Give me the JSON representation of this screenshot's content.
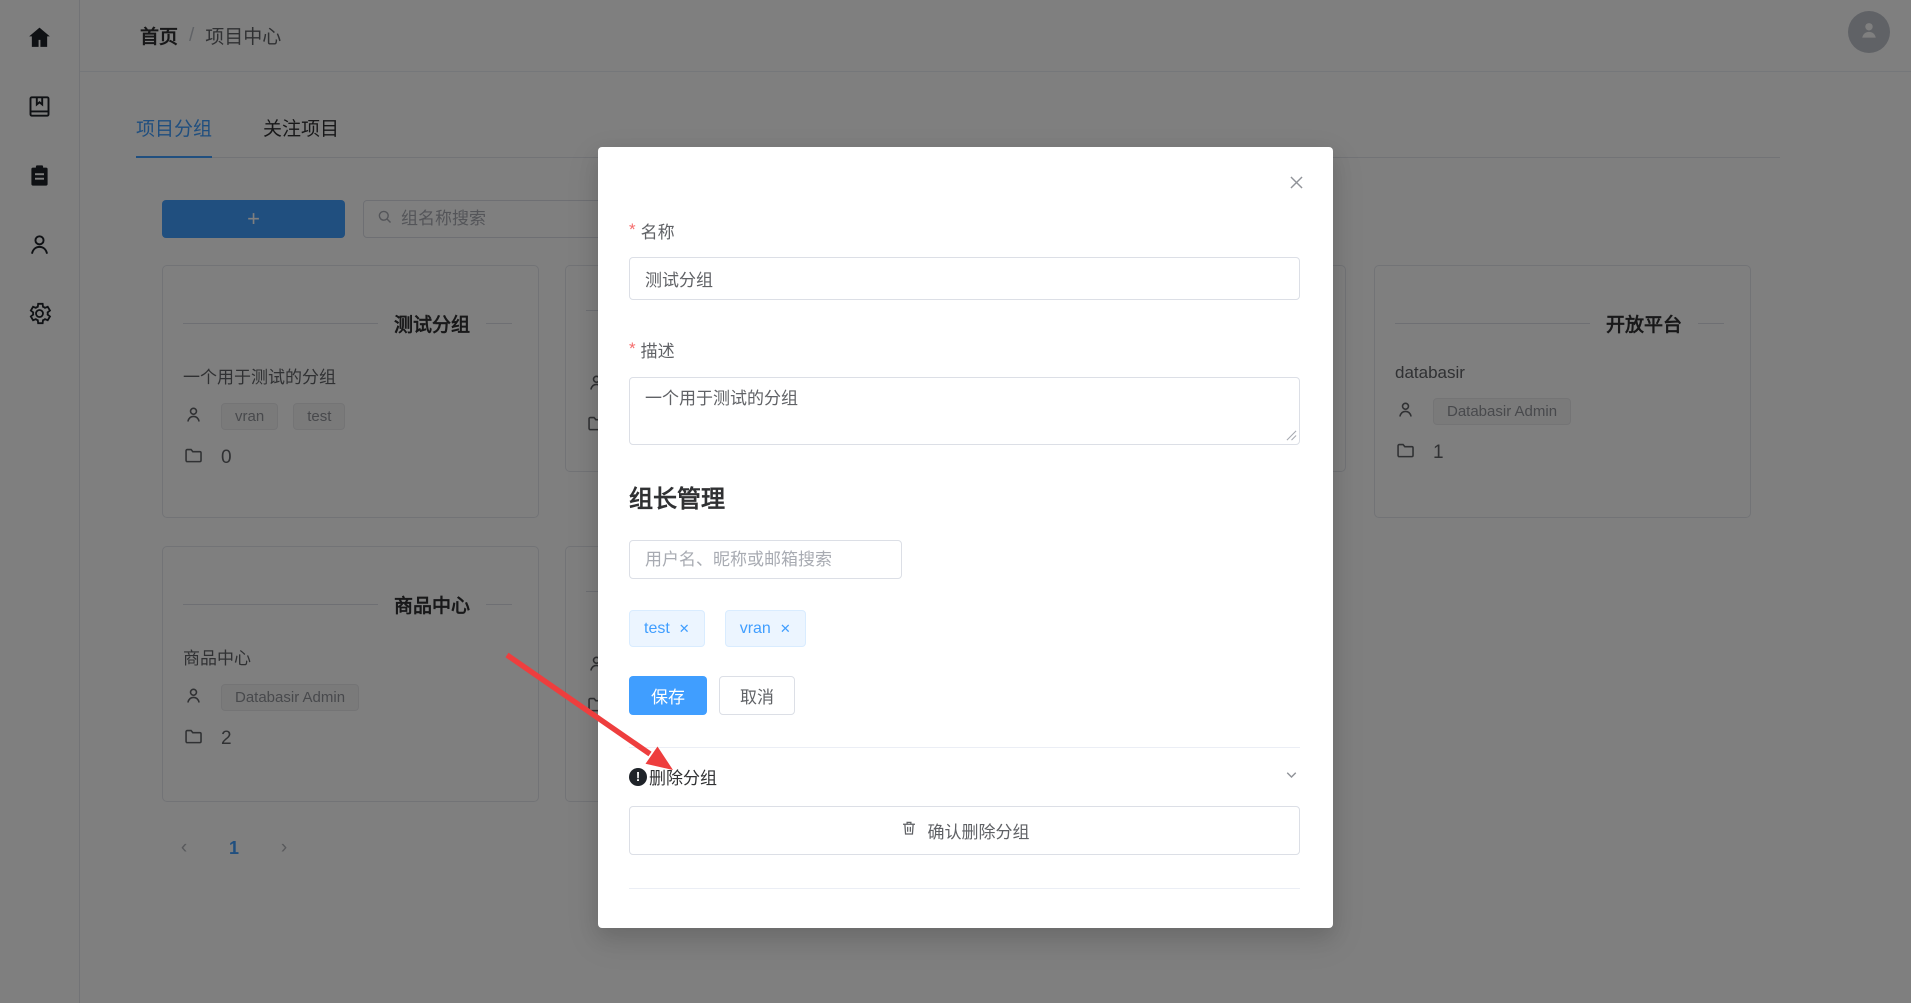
{
  "app": {
    "colors": {
      "primary": "#409eff",
      "danger_mark": "#f56c6c",
      "annotation_arrow": "#ee3e3e",
      "overlay": "rgba(0,0,0,0.5)"
    },
    "icons": [
      "home-icon",
      "book-icon",
      "clipboard-icon",
      "user-icon",
      "settings-icon",
      "avatar-icon",
      "search-icon",
      "member-icon",
      "folder-icon",
      "close-icon",
      "warning-icon",
      "chevron-down-icon",
      "trash-icon",
      "tag-close-icon"
    ]
  },
  "header": {
    "breadcrumb": {
      "home": "首页",
      "separator": "/",
      "current": "项目中心"
    }
  },
  "tabs": {
    "items": [
      {
        "label": "项目分组"
      },
      {
        "label": "关注项目"
      }
    ],
    "active": "项目分组"
  },
  "toolbar": {
    "add_button_label": "+",
    "search_placeholder": "组名称搜索"
  },
  "groups": [
    {
      "title": "测试分组",
      "description": "一个用于测试的分组",
      "members": [
        "vran",
        "test"
      ],
      "project_count": "0"
    },
    {
      "title": "商品中心",
      "description": "商品中心",
      "members": [
        "Databasir Admin"
      ],
      "project_count": "2"
    },
    {
      "title": "开放平台",
      "description": "databasir",
      "members": [
        "Databasir Admin"
      ],
      "project_count": "1"
    }
  ],
  "pagination": {
    "prev": "‹",
    "current_page": "1",
    "next": "›"
  },
  "dialog": {
    "required_mark": "*",
    "name_label": "名称",
    "name_value": "测试分组",
    "description_label": "描述",
    "description_value": "一个用于测试的分组",
    "section_title": "组长管理",
    "member_search_placeholder": "用户名、昵称或邮箱搜索",
    "member_tags": [
      {
        "label": "test"
      },
      {
        "label": "vran"
      }
    ],
    "tag_remove_glyph": "✕",
    "save_button": "保存",
    "cancel_button": "取消",
    "delete_section_title": "删除分组",
    "warning_glyph": "!",
    "confirm_delete_button": "确认删除分组"
  }
}
